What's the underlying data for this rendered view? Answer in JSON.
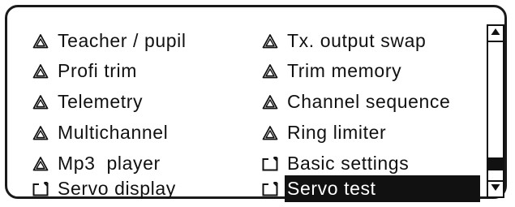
{
  "menu": {
    "items": [
      {
        "label": "Teacher / pupil",
        "icon": "warning-icon"
      },
      {
        "label": "Tx. output swap",
        "icon": "warning-icon"
      },
      {
        "label": "Profi trim",
        "icon": "warning-icon"
      },
      {
        "label": "Trim memory",
        "icon": "warning-icon"
      },
      {
        "label": "Telemetry",
        "icon": "warning-icon"
      },
      {
        "label": "Channel sequence",
        "icon": "warning-icon"
      },
      {
        "label": "Multichannel",
        "icon": "warning-icon"
      },
      {
        "label": "Ring limiter",
        "icon": "warning-icon"
      },
      {
        "label": "Mp3  player",
        "icon": "warning-icon"
      },
      {
        "label": "Basic settings",
        "icon": "return-icon"
      },
      {
        "label": "Servo display",
        "icon": "return-icon"
      },
      {
        "label": "Servo test",
        "icon": "return-icon",
        "selected": true
      }
    ]
  },
  "scrollbar": {
    "position": 0.92,
    "up_icon": "arrow-up-icon",
    "down_icon": "arrow-down-icon"
  },
  "colors": {
    "foreground": "#111111",
    "background": "#ffffff",
    "selection_bg": "#111111",
    "selection_fg": "#ffffff"
  }
}
